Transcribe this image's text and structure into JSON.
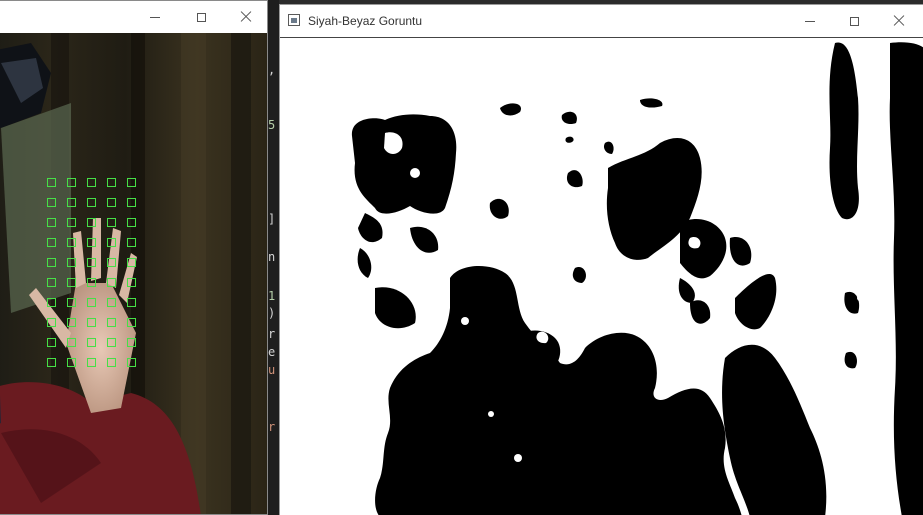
{
  "camera_window": {
    "title": "",
    "grid": {
      "rows": 10,
      "cols": 5,
      "color": "#46e046"
    }
  },
  "bw_window": {
    "title": "Siyah-Beyaz Goruntu"
  },
  "code_fragments": [
    {
      "text": ",",
      "color": "#d4d4d4"
    },
    {
      "text": "5",
      "color": "#b5cea8"
    },
    {
      "text": "]",
      "color": "#d4d4d4"
    },
    {
      "text": "n",
      "color": "#d4d4d4"
    },
    {
      "text": "1",
      "color": "#b5cea8"
    },
    {
      "text": ")",
      "color": "#d4d4d4"
    },
    {
      "text": "r",
      "color": "#d4d4d4"
    },
    {
      "text": "e",
      "color": "#d4d4d4"
    },
    {
      "text": "u",
      "color": "#ce9178"
    },
    {
      "text": "r",
      "color": "#ce9178"
    }
  ]
}
